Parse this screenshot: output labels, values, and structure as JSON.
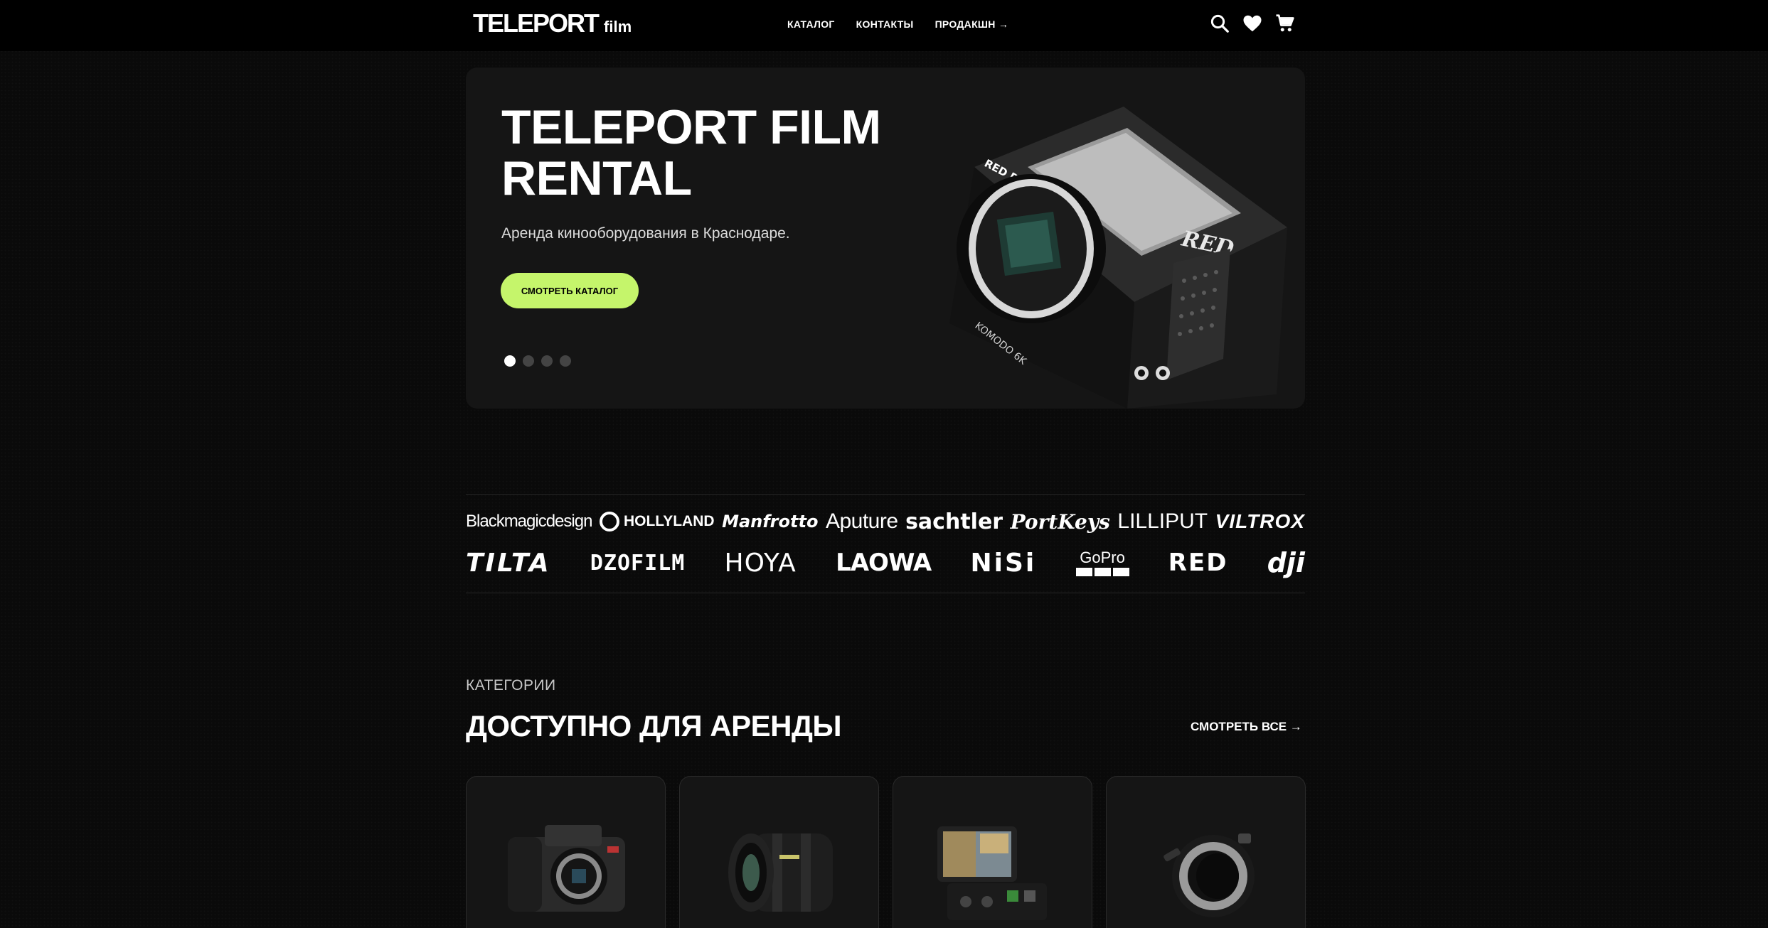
{
  "header": {
    "logo_main": "TELEPORT",
    "logo_sub": "film",
    "nav": [
      "КАТАЛОГ",
      "КОНТАКТЫ",
      "ПРОДАКШН →"
    ],
    "icons": [
      "search-icon",
      "heart-icon",
      "cart-icon"
    ]
  },
  "hero": {
    "title": "TELEPORT FILM RENTAL",
    "subtitle": "Аренда кинооборудования в Краснодаре.",
    "button": "СМОТРЕТЬ КАТАЛОГ",
    "slides": 4,
    "active_slide": 1,
    "camera_labels": {
      "brand": "RED DIGITAL CINEMA",
      "logo": "RED",
      "model": "KOMODO 6K"
    }
  },
  "brands": {
    "row1": [
      "Blackmagicdesign",
      "HOLLYLAND",
      "Manfrotto",
      "Aputure",
      "sachtler",
      "PortKeys",
      "LILLIPUT",
      "VILTROX"
    ],
    "row2": [
      "TILTA",
      "DZOFILM",
      "HOYA",
      "LAOWA",
      "NiSi",
      "GoPro",
      "RED",
      "dji"
    ]
  },
  "categories": {
    "label": "КАТЕГОРИИ",
    "title": "ДОСТУПНО ДЛЯ АРЕНДЫ",
    "see_all": "СМОТРЕТЬ ВСЕ →",
    "cards": [
      "camera-product-image",
      "cine-lens-product-image",
      "monitor-recorder-product-image",
      "lens-adapter-product-image"
    ]
  },
  "colors": {
    "accent": "#c5f56b",
    "background": "#0a0a0a",
    "card": "#151515"
  }
}
